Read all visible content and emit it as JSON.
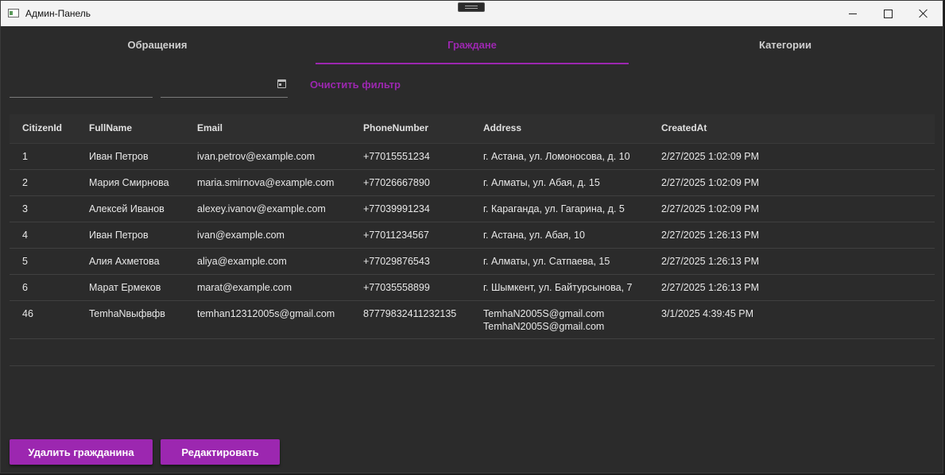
{
  "window": {
    "title": "Админ-Панель"
  },
  "tabs": [
    {
      "label": "Обращения",
      "active": false
    },
    {
      "label": "Граждане",
      "active": true
    },
    {
      "label": "Категории",
      "active": false
    }
  ],
  "filters": {
    "text_value": "",
    "date_value": "",
    "clear_label": "Очистить фильтр"
  },
  "table": {
    "columns": [
      "CitizenId",
      "FullName",
      "Email",
      "PhoneNumber",
      "Address",
      "CreatedAt"
    ],
    "rows": [
      [
        "1",
        "Иван Петров",
        "ivan.petrov@example.com",
        "+77015551234",
        "г. Астана, ул. Ломоносова, д. 10",
        "2/27/2025 1:02:09 PM"
      ],
      [
        "2",
        "Мария Смирнова",
        "maria.smirnova@example.com",
        "+77026667890",
        "г. Алматы, ул. Абая, д. 15",
        "2/27/2025 1:02:09 PM"
      ],
      [
        "3",
        "Алексей Иванов",
        "alexey.ivanov@example.com",
        "+77039991234",
        "г. Караганда, ул. Гагарина, д. 5",
        "2/27/2025 1:02:09 PM"
      ],
      [
        "4",
        "Иван Петров",
        "ivan@example.com",
        "+77011234567",
        "г. Астана, ул. Абая, 10",
        "2/27/2025 1:26:13 PM"
      ],
      [
        "5",
        "Алия Ахметова",
        "aliya@example.com",
        "+77029876543",
        "г. Алматы, ул. Сатпаева, 15",
        "2/27/2025 1:26:13 PM"
      ],
      [
        "6",
        "Марат Ермеков",
        "marat@example.com",
        "+77035558899",
        "г. Шымкент, ул. Байтурсынова, 7",
        "2/27/2025 1:26:13 PM"
      ],
      [
        "46",
        "TemhaNвыфвфв",
        "temhan12312005s@gmail.com",
        "87779832411232135",
        "TemhaN2005S@gmail.com\nTemhaN2005S@gmail.com",
        "3/1/2025 4:39:45 PM"
      ]
    ]
  },
  "actions": {
    "delete_label": "Удалить гражданина",
    "edit_label": "Редактировать"
  },
  "colors": {
    "accent": "#9c27b0",
    "background": "#2b2b2b",
    "titlebar": "#f3f3f3"
  }
}
